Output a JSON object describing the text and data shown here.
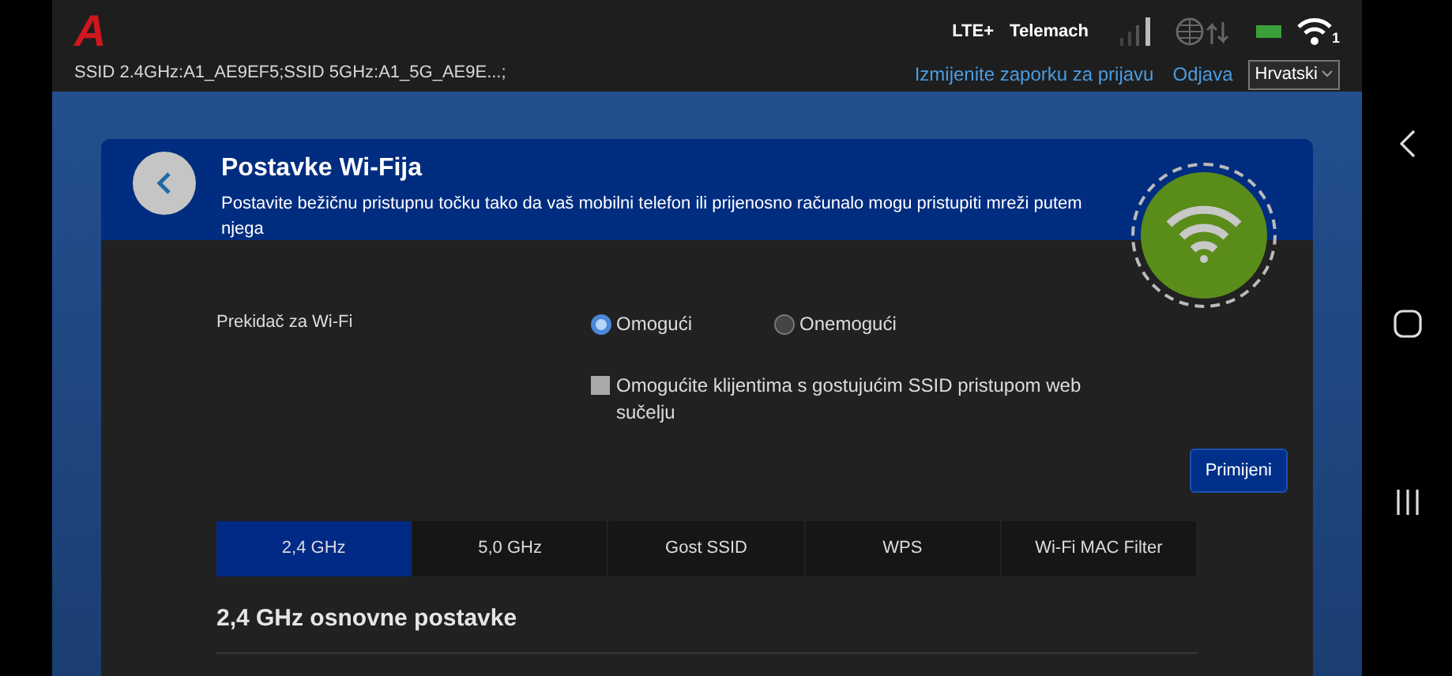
{
  "top_bar": {
    "logo": "A",
    "ssid_info": "SSID 2.4GHz:A1_AE9EF5;SSID 5GHz:A1_5G_AE9E...;",
    "network_type": "LTE+",
    "operator": "Telemach",
    "wifi_clients": "1",
    "links": [
      "Izmijenite zaporku za prijavu",
      "Odjava"
    ],
    "language": "Hrvatski"
  },
  "card": {
    "title": "Postavke Wi-Fija",
    "description": "Postavite bežičnu pristupnu točku tako da vaš mobilni telefon ili prijenosno računalo mogu pristupiti mreži putem njega",
    "wifi_switch": {
      "label": "Prekidač za Wi-Fi",
      "options": [
        {
          "label": "Omogući",
          "selected": true
        },
        {
          "label": "Onemogući",
          "selected": false
        }
      ]
    },
    "guest_access": {
      "label": "Omogućite klijentima s gostujućim SSID pristupom web sučelju",
      "checked": false
    },
    "apply_button": "Primijeni",
    "tabs": [
      {
        "label": "2,4 GHz",
        "selected": true
      },
      {
        "label": "5,0 GHz",
        "selected": false
      },
      {
        "label": "Gost SSID",
        "selected": false
      },
      {
        "label": "WPS",
        "selected": false
      },
      {
        "label": "Wi-Fi MAC Filter",
        "selected": false
      }
    ],
    "section_title": "2,4 GHz osnovne postavke"
  }
}
